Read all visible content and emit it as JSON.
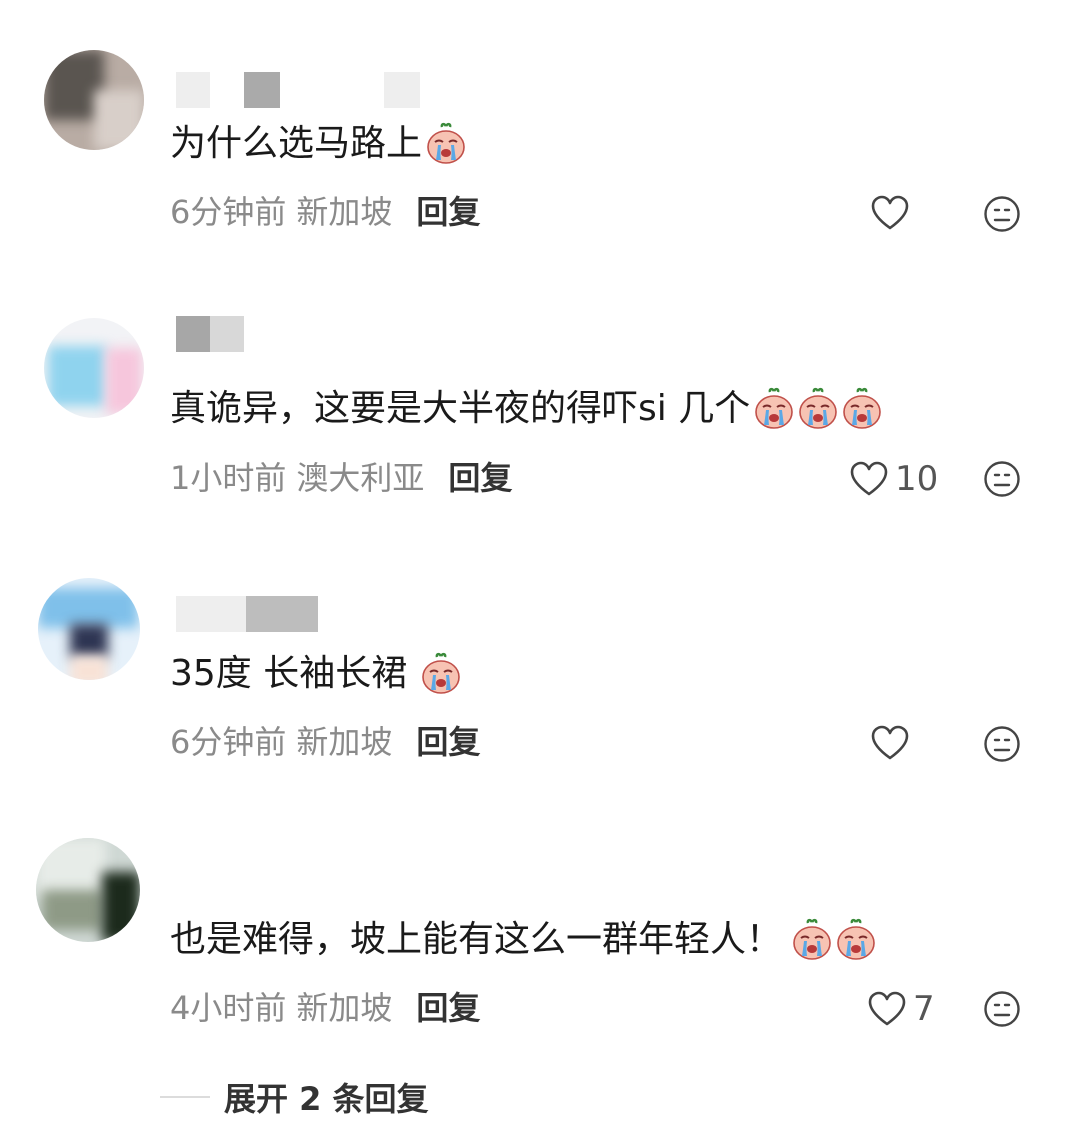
{
  "comments": [
    {
      "text": "为什么选马路上",
      "emoji_count": 1,
      "time": "6分钟前",
      "location": "新加坡",
      "reply_label": "回复",
      "likes": ""
    },
    {
      "text": "真诡异，这要是大半夜的得吓si 几个",
      "emoji_count": 3,
      "time": "1小时前",
      "location": "澳大利亚",
      "reply_label": "回复",
      "likes": "10"
    },
    {
      "text": "35度 长袖长裙",
      "emoji_count": 1,
      "time": "6分钟前",
      "location": "新加坡",
      "reply_label": "回复",
      "likes": ""
    },
    {
      "text": "也是难得，坡上能有这么一群年轻人！",
      "emoji_count": 2,
      "time": "4小时前",
      "location": "新加坡",
      "reply_label": "回复",
      "likes": "7"
    }
  ],
  "expand_replies": "展开 2 条回复",
  "icons": {
    "emoji": "crying-face-emoji-icon",
    "like": "heart-outline-icon",
    "dislike": "neutral-face-icon"
  },
  "colors": {
    "meta_text": "#8a8a8a",
    "icon_stroke": "#444444",
    "emoji_face": "#f6b9a7"
  }
}
